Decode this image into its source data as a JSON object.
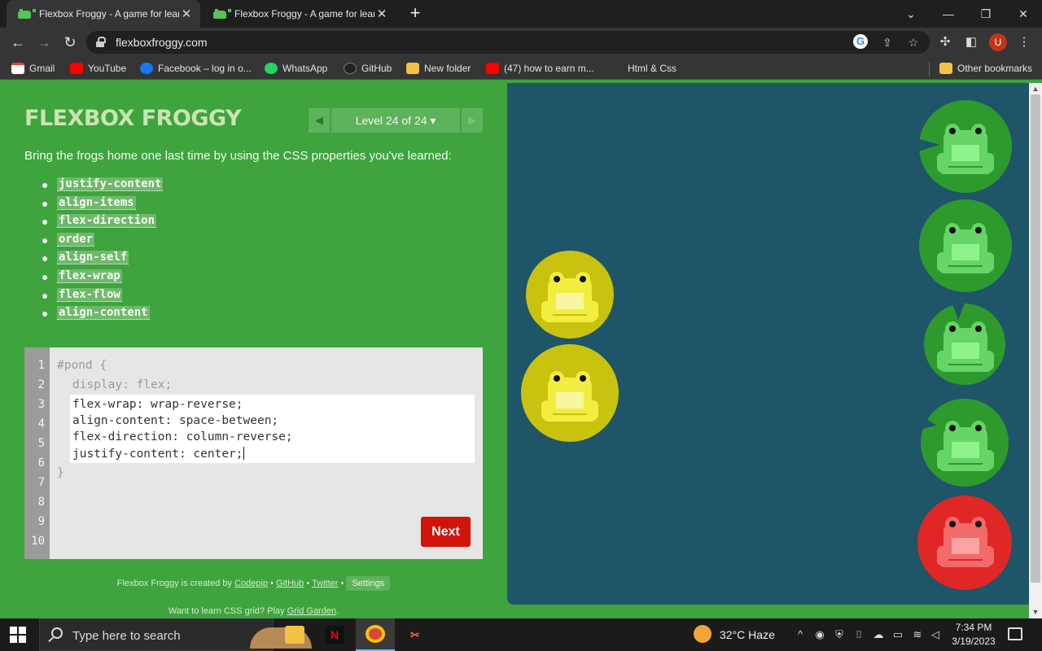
{
  "browser": {
    "tabs": [
      {
        "title": "Flexbox Froggy - A game for learning CSS flexbox",
        "active": true
      },
      {
        "title": "Flexbox Froggy - A game for learning CSS flexbox",
        "active": false
      }
    ],
    "new_tab": "+",
    "url": "flexboxfroggy.com",
    "bookmarks": [
      {
        "label": "Gmail",
        "icon": "gmail-icon"
      },
      {
        "label": "YouTube",
        "icon": "youtube-icon"
      },
      {
        "label": "Facebook – log in o...",
        "icon": "facebook-icon"
      },
      {
        "label": "WhatsApp",
        "icon": "whatsapp-icon"
      },
      {
        "label": "GitHub",
        "icon": "github-icon"
      },
      {
        "label": "New folder",
        "icon": "folder-icon"
      },
      {
        "label": "(47) how to earn m...",
        "icon": "youtube-icon"
      },
      {
        "label": "Html & Css",
        "icon": ""
      }
    ],
    "other_bookmarks": "Other bookmarks",
    "profile_initial": "U"
  },
  "game": {
    "logo": "FLEXBOX FROGGY",
    "level_label": "Level 24 of 24 ▾",
    "instructions": "Bring the frogs home one last time by using the CSS properties you've learned:",
    "properties": [
      "justify-content",
      "align-items",
      "flex-direction",
      "order",
      "align-self",
      "flex-wrap",
      "flex-flow",
      "align-content"
    ],
    "line_numbers": [
      "1",
      "2",
      "3",
      "4",
      "5",
      "6",
      "7",
      "8",
      "9",
      "10"
    ],
    "code_open": "#pond {",
    "code_display": "display: flex;",
    "code_close": "}",
    "input_lines": [
      "flex-wrap: wrap-reverse;",
      "align-content: space-between;",
      "flex-direction: column-reverse;",
      "justify-content: center;"
    ],
    "next_label": "Next",
    "credits_prefix": "Flexbox Froggy is created by",
    "credits_links": [
      "Codepip",
      "GitHub",
      "Twitter"
    ],
    "settings_label": "Settings",
    "grid_prefix": "Want to learn CSS grid? Play",
    "grid_link": "Grid Garden",
    "grid_suffix": "."
  },
  "colors": {
    "page_green": "#3fa33e",
    "pond_blue": "#1e5568",
    "frog_green": "#66d466",
    "frog_yellow": "#f2ee40",
    "frog_red": "#f26a6a",
    "next_red": "#d0140c"
  },
  "taskbar": {
    "search_placeholder": "Type here to search",
    "weather": "32°C  Haze",
    "time": "7:34 PM",
    "date": "3/19/2023"
  }
}
